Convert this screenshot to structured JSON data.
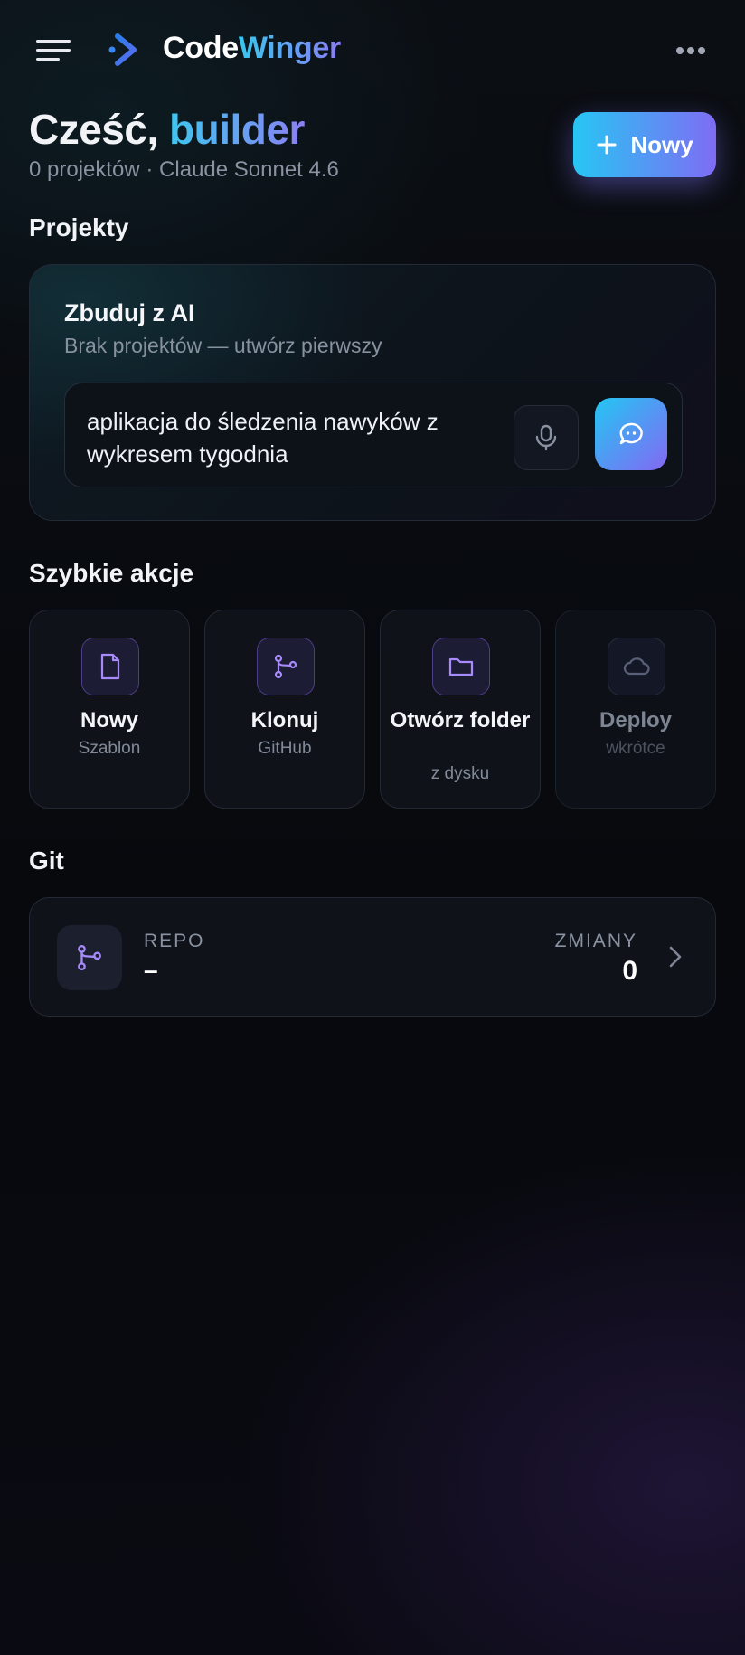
{
  "header": {
    "brand_part1": "Code",
    "brand_part2": "Winger",
    "menu_icon": "hamburger-icon",
    "logo_icon": "chevron-right-logo-icon",
    "more_icon": "more-horizontal-icon"
  },
  "greeting": {
    "prefix": "Cześć,",
    "name": "builder",
    "subline": "0 projektów · Claude Sonnet 4.6"
  },
  "new_button": {
    "label": "Nowy",
    "icon": "plus-icon"
  },
  "sections": {
    "projects": "Projekty",
    "quick_actions": "Szybkie akcje",
    "git": "Git"
  },
  "ai_card": {
    "title": "Zbuduj z AI",
    "subtitle": "Brak projektów — utwórz pierwszy",
    "prompt_value": "aplikacja do śledzenia nawyków z wykresem tygodnia",
    "mic_icon": "microphone-icon",
    "send_icon": "chat-bubble-icon"
  },
  "quick_actions": [
    {
      "label": "Nowy",
      "sub": "Szablon",
      "icon": "file-icon",
      "enabled": true
    },
    {
      "label": "Klonuj",
      "sub": "GitHub",
      "icon": "git-branch-icon",
      "enabled": true
    },
    {
      "label": "Otwórz folder",
      "sub": "z dysku",
      "icon": "folder-icon",
      "enabled": true
    },
    {
      "label": "Deploy",
      "sub": "wkrótce",
      "icon": "cloud-icon",
      "enabled": false
    }
  ],
  "git": {
    "repo_label": "REPO",
    "repo_value": "–",
    "changes_label": "ZMIANY",
    "changes_value": "0",
    "icon": "git-branch-icon",
    "chevron_icon": "chevron-right-icon"
  },
  "colors": {
    "accent_cyan": "#27c6f4",
    "accent_purple": "#7f6cf4",
    "background": "#07090d"
  }
}
